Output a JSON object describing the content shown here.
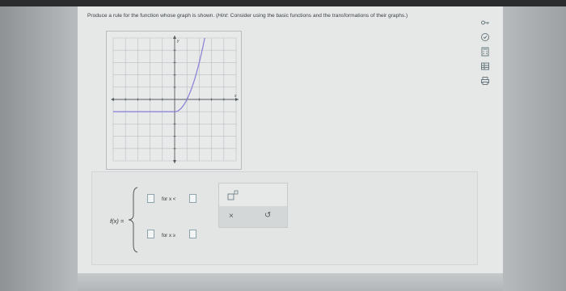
{
  "question": {
    "prefix": "Produce a rule for the function whose graph is shown. (",
    "hint_label": "Hint",
    "hint_text": ": Consider using the basic functions and the transformations of their graphs.)"
  },
  "graph": {
    "axis_x_label": "x",
    "axis_y_label": "y"
  },
  "answer": {
    "function_label": "f(x) =",
    "row1_condition": "for x <",
    "row2_condition": "for x ≥"
  },
  "palette": {
    "superscript_tool_icon": "superscript-box-icon",
    "clear_icon": "×",
    "undo_icon": "↺"
  },
  "side_tools": [
    "key-icon",
    "check-circle-icon",
    "calculator-icon",
    "table-icon",
    "print-icon"
  ],
  "colors": {
    "graph_curve": "#8d86d8",
    "grid": "#b9bec1",
    "axis": "#555b60"
  }
}
